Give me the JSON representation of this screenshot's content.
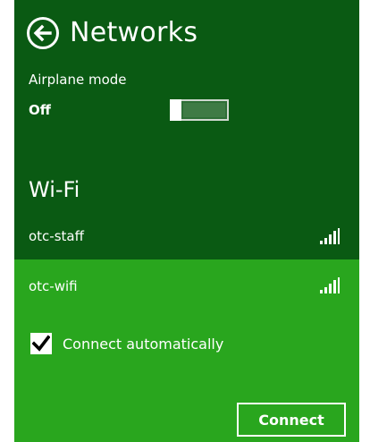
{
  "header": {
    "title": "Networks",
    "back_icon": "back-arrow-circle-icon"
  },
  "airplane_mode": {
    "label": "Airplane mode",
    "state": "Off",
    "enabled": false
  },
  "wifi": {
    "heading": "Wi-Fi",
    "networks": [
      {
        "name": "otc-staff",
        "signal_icon": "signal-strength-icon",
        "selected": false
      },
      {
        "name": "otc-wifi",
        "signal_icon": "signal-strength-icon",
        "selected": true
      }
    ],
    "connect_automatically": {
      "label": "Connect automatically",
      "checked": true
    },
    "connect_button": "Connect"
  },
  "colors": {
    "panel_background": "#0a5a13",
    "selected_network_background": "#29a61e",
    "text": "#ffffff"
  }
}
